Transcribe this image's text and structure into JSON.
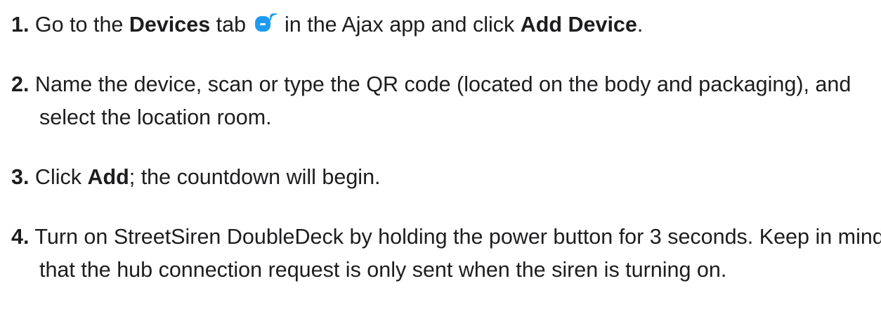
{
  "instructions": {
    "steps": [
      {
        "number": "1.",
        "text_a": " Go to the ",
        "bold_a": "Devices",
        "text_b": " tab ",
        "icon": "devices-tab-icon",
        "text_c": " in the Ajax app and click ",
        "bold_b": "Add Device",
        "text_d": "."
      },
      {
        "number": "2.",
        "text": " Name the device, scan or type the QR code (located on the body and packaging), and select the location room."
      },
      {
        "number": "3.",
        "text_a": " Click ",
        "bold_a": "Add",
        "text_b": "; the countdown will begin."
      },
      {
        "number": "4.",
        "text": " Turn on StreetSiren DoubleDeck by holding the power button for 3 seconds. Keep in mind that the hub connection request is only sent when the siren is turning on."
      }
    ]
  },
  "colors": {
    "text": "#1d1d1f",
    "icon_blue": "#1e9bf0"
  }
}
